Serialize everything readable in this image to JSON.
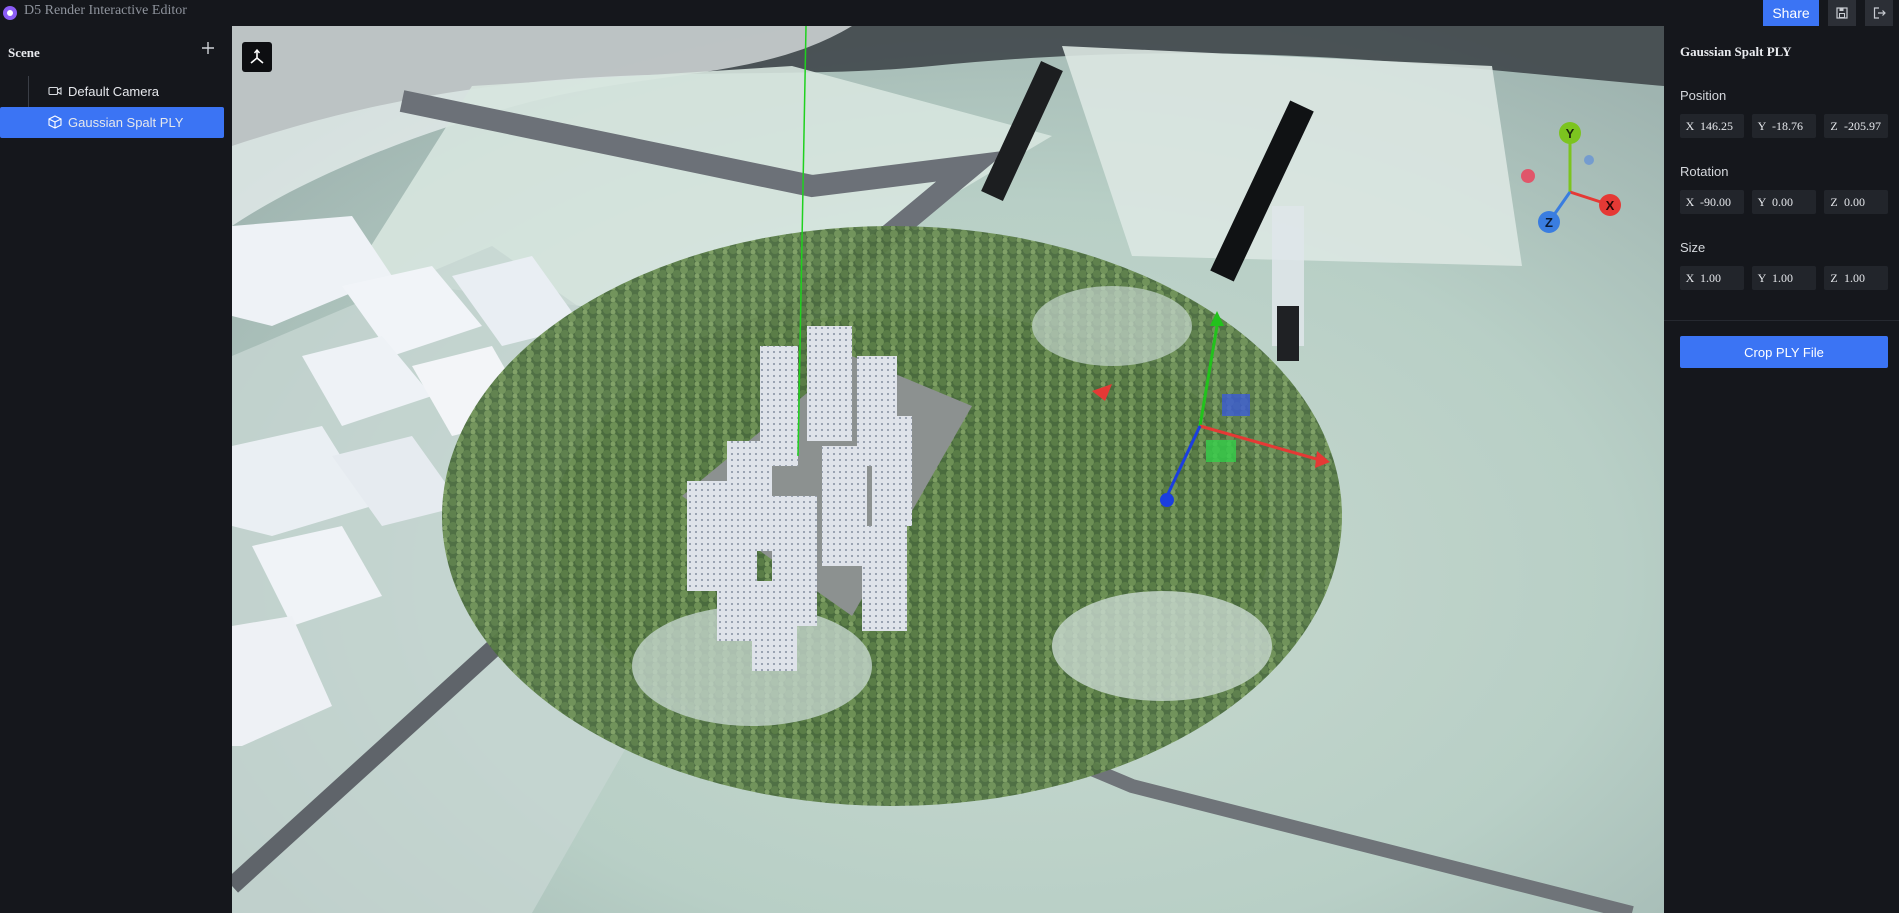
{
  "app": {
    "title": "D5 Render Interactive Editor"
  },
  "header": {
    "share_label": "Share",
    "save_icon": "save-icon",
    "exit_icon": "exit-icon"
  },
  "scene": {
    "title": "Scene",
    "add_icon": "plus-icon",
    "items": [
      {
        "label": "Default Camera",
        "icon": "camera-icon",
        "selected": false
      },
      {
        "label": "Gaussian Spalt PLY",
        "icon": "cube-icon",
        "selected": true
      }
    ]
  },
  "viewport": {
    "gizmo_labels": {
      "x": "X",
      "y": "Y",
      "z": "Z"
    },
    "colors": {
      "x_axis": "#e53935",
      "y_axis": "#7cc41f",
      "z_axis": "#3a7de0"
    }
  },
  "properties": {
    "title": "Gaussian Spalt PLY",
    "position": {
      "label": "Position",
      "x": "146.25",
      "y": "-18.76",
      "z": "-205.97"
    },
    "rotation": {
      "label": "Rotation",
      "x": "-90.00",
      "y": "0.00",
      "z": "0.00"
    },
    "size": {
      "label": "Size",
      "x": "1.00",
      "y": "1.00",
      "z": "1.00"
    },
    "axis_labels": {
      "x": "X",
      "y": "Y",
      "z": "Z"
    },
    "crop_label": "Crop PLY File"
  },
  "theme": {
    "accent": "#3b74f4",
    "background": "#15171c",
    "field_bg": "#22252b"
  }
}
